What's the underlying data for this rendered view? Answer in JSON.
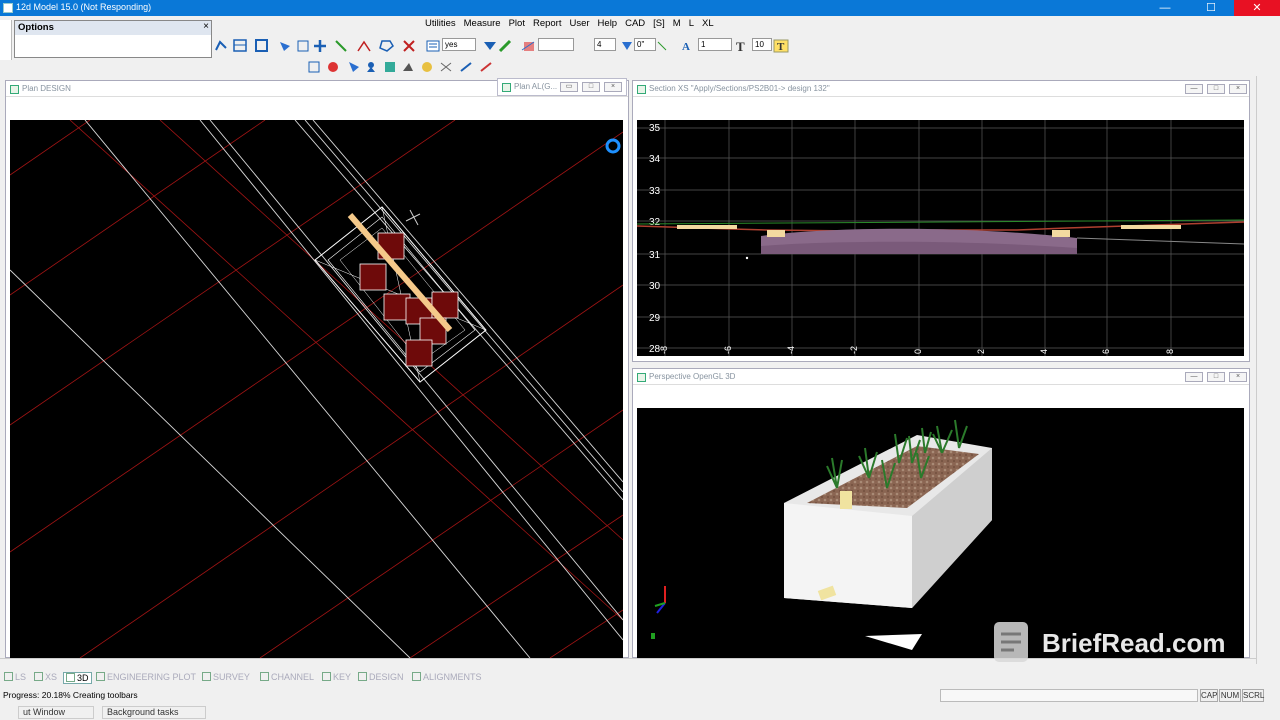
{
  "window": {
    "title": "12d Model 15.0 (Not Responding)",
    "minimize": "—",
    "maximize": "☐",
    "close": "✕"
  },
  "menu": [
    "Utilities",
    "Measure",
    "Plot",
    "Report",
    "User",
    "Help",
    "CAD",
    "[S]",
    "M",
    "L",
    "XL"
  ],
  "options_panel": {
    "title": "Options",
    "close": "×"
  },
  "toolbar": {
    "yes_value": "yes",
    "field_4": "4",
    "field_0": "0\"",
    "field_1": "1",
    "field_10": "10"
  },
  "panels": {
    "plan_design": {
      "title": "Plan DESIGN"
    },
    "plan_al": {
      "title": "Plan AL(G..."
    },
    "section": {
      "title": "Section XS \"Apply/Sections/PS2B01-> design 132\""
    },
    "perspective": {
      "title": "Perspective OpenGL 3D"
    }
  },
  "section_axis": {
    "y_ticks": [
      "35",
      "34",
      "33",
      "32",
      "31",
      "30",
      "29",
      "28"
    ],
    "x_ticks": [
      "-8",
      "-6",
      "-4",
      "-2",
      "0",
      "2",
      "4",
      "6",
      "8"
    ]
  },
  "tabs": [
    {
      "label": "LS",
      "active": false
    },
    {
      "label": "XS",
      "active": false
    },
    {
      "label": "3D",
      "active": true
    },
    {
      "label": "ENGINEERING PLOT",
      "active": false
    },
    {
      "label": "SURVEY",
      "active": false
    },
    {
      "label": "CHANNEL",
      "active": false
    },
    {
      "label": "KEY",
      "active": false
    },
    {
      "label": "DESIGN",
      "active": false
    },
    {
      "label": "ALIGNMENTS",
      "active": false
    }
  ],
  "status": {
    "progress": "Progress: 20.18% Creating toolbars",
    "cap": "CAP",
    "num": "NUM",
    "scrl": "SCRL"
  },
  "bottom": {
    "output_window": "ut Window",
    "background_tasks": "Background tasks"
  },
  "watermark": {
    "text": "BriefRead.com"
  },
  "colors": {
    "titlebar": "#0a78d7",
    "grid_red": "#b01818",
    "view_bg": "#000000"
  }
}
